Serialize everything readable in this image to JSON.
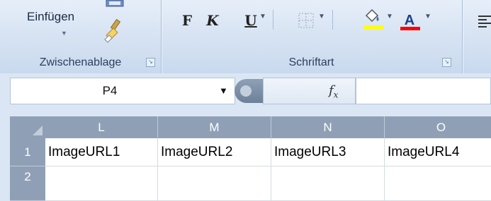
{
  "ribbon": {
    "clipboard": {
      "paste_label": "Einfügen",
      "group_label": "Zwischenablage"
    },
    "font": {
      "group_label": "Schriftart",
      "bold_label": "F",
      "italic_label": "K",
      "underline_label": "U",
      "font_color_label": "A",
      "highlight_color": "#ffff00",
      "font_color": "#ff0000"
    }
  },
  "formula_bar": {
    "name_box_value": "P4",
    "fx_label": "fx",
    "formula_value": ""
  },
  "sheet": {
    "columns": [
      "L",
      "M",
      "N",
      "O"
    ],
    "rows": [
      {
        "number": "1",
        "cells": [
          "ImageURL1",
          "ImageURL2",
          "ImageURL3",
          "ImageURL4"
        ]
      },
      {
        "number": "2",
        "cells": [
          "",
          "",
          "",
          ""
        ]
      }
    ]
  },
  "colors": {
    "header_bg": "#8fa0b6",
    "ribbon_bg": "#d8e4f3"
  }
}
